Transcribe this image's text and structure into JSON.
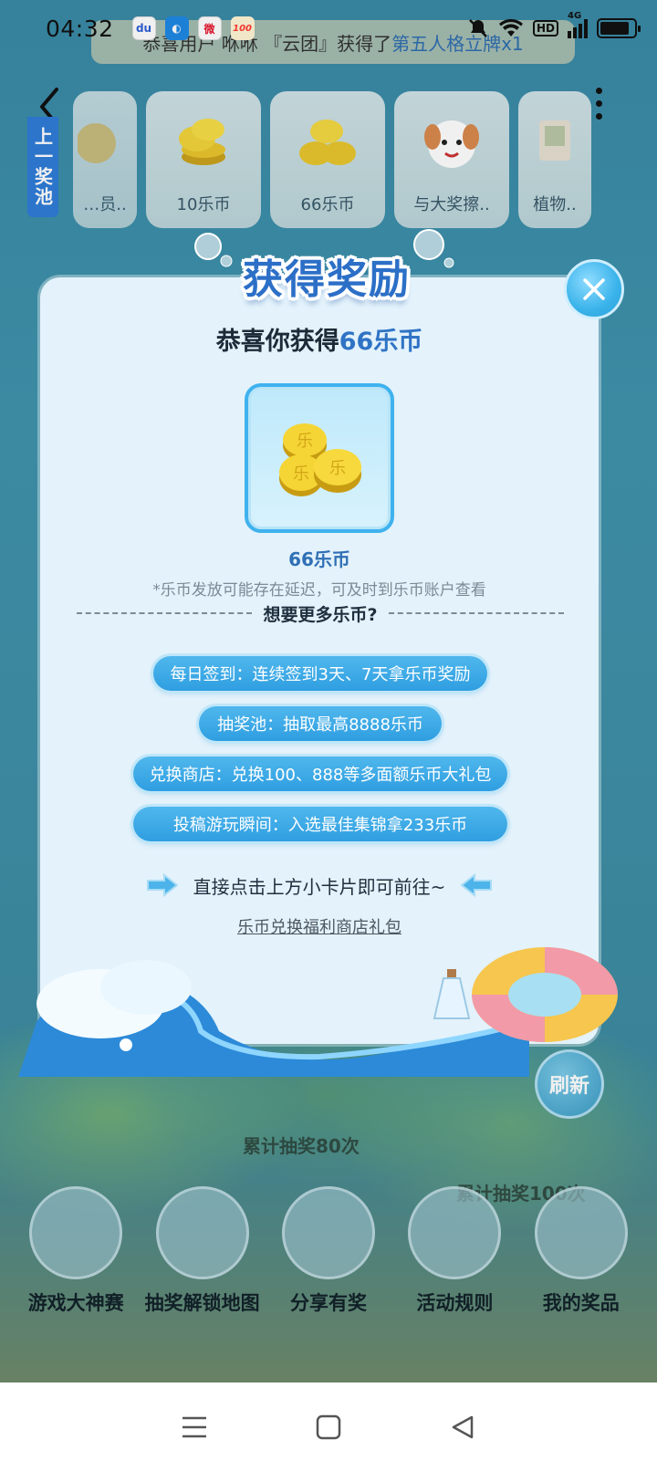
{
  "status_bar": {
    "time": "04:32",
    "apps": [
      {
        "icon": "baidu-icon",
        "glyph": "du",
        "color": "#2f5fd6"
      },
      {
        "icon": "browser-icon",
        "glyph": "◐",
        "color": "#1e88e5"
      },
      {
        "icon": "weibo-icon",
        "glyph": "微",
        "color": "#e6162d"
      },
      {
        "icon": "zuoyebang-icon",
        "glyph": "100",
        "color": "#ff3b30"
      }
    ],
    "network_labels": [
      "HD",
      "4G"
    ],
    "battery_level": 0.85
  },
  "marquee": {
    "text": "恭喜用户 咻咻 『云团』获得了",
    "highlight": "第五人格立牌x1"
  },
  "prev_pool_label": "上一奖池",
  "prize_strip": [
    {
      "label": "…员..",
      "icon": "partial-prize-icon"
    },
    {
      "label": "10乐币",
      "icon": "coins-icon"
    },
    {
      "label": "66乐币",
      "icon": "coins-icon"
    },
    {
      "label": "与大奖擦..",
      "icon": "dog-mascot-icon"
    },
    {
      "label": "植物..",
      "icon": "plant-card-icon"
    }
  ],
  "modal": {
    "title": "获得奖励",
    "headline_prefix": "恭喜你获得",
    "headline_amount": "66乐币",
    "reward_name": "66乐币",
    "reward_note": "*乐币发放可能存在延迟，可及时到乐币账户查看",
    "divider_text": "想要更多乐币?",
    "tips": [
      "每日签到：连续签到3天、7天拿乐币奖励",
      "抽奖池：抽取最高8888乐币",
      "兑换商店：兑换100、888等多面额乐币大礼包",
      "投稿游玩瞬间：入选最佳集锦拿233乐币"
    ],
    "goto_text": "直接点击上方小卡片即可前往~",
    "link_text": "乐币兑换福利商店礼包"
  },
  "scene": {
    "refresh_label": "刷新",
    "milestone_left": "累计抽奖80次",
    "milestone_right": "累计抽奖100次"
  },
  "bottom_nav": [
    {
      "label": "游戏大神赛",
      "icon": "tv-icon"
    },
    {
      "label": "抽奖解锁地图",
      "icon": "map-icon"
    },
    {
      "label": "分享有奖",
      "icon": "share-icon"
    },
    {
      "label": "活动规则",
      "icon": "rules-book-icon"
    },
    {
      "label": "我的奖品",
      "icon": "gift-icon"
    }
  ],
  "colors": {
    "accent_blue": "#2f73c5",
    "pill_blue": "#3aa8e6",
    "modal_bg": "#e3f2fb"
  }
}
